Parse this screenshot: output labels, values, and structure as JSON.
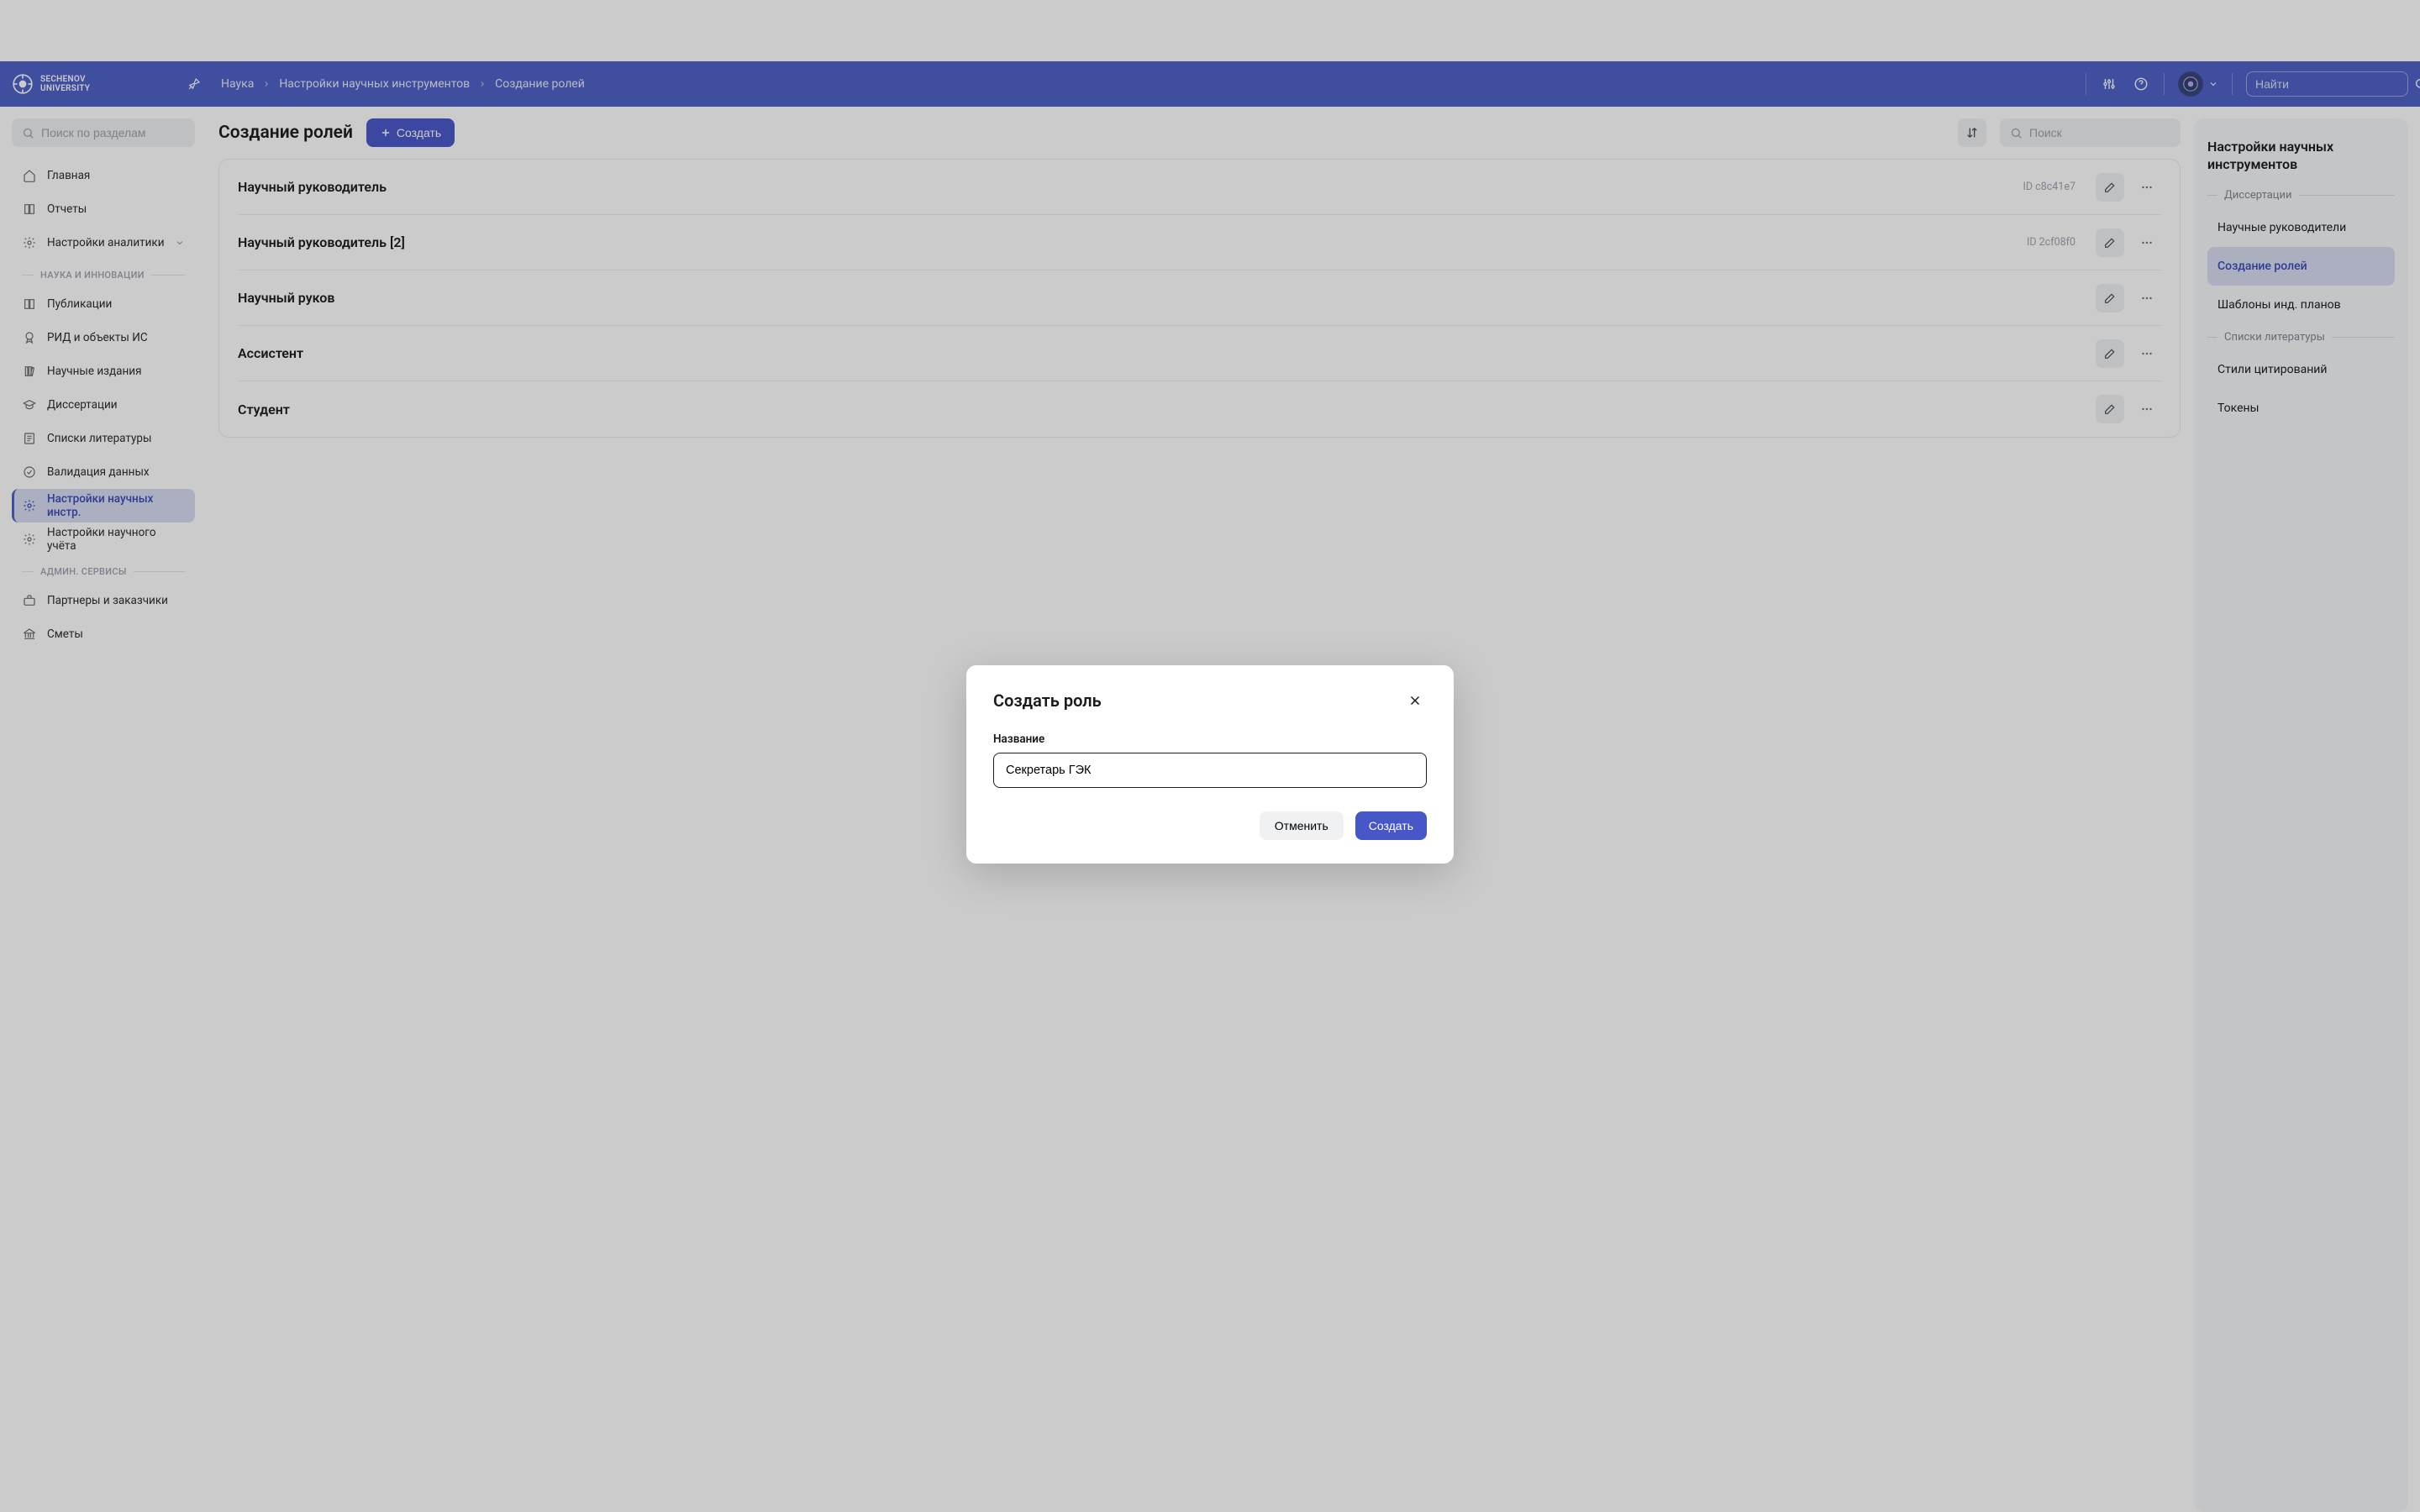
{
  "brand": {
    "name": "SECHENOV",
    "sub": "UNIVERSITY"
  },
  "breadcrumbs": [
    "Наука",
    "Настройки научных инструментов",
    "Создание ролей"
  ],
  "topSearch": {
    "placeholder": "Найти"
  },
  "sidebar": {
    "search_placeholder": "Поиск по разделам",
    "items_top": [
      {
        "label": "Главная",
        "icon": "home"
      },
      {
        "label": "Отчеты",
        "icon": "book"
      },
      {
        "label": "Настройки аналитики",
        "icon": "gear",
        "expandable": true
      }
    ],
    "section_science": "НАУКА И ИННОВАЦИИ",
    "items_science": [
      {
        "label": "Публикации",
        "icon": "book"
      },
      {
        "label": "РИД и объекты ИС",
        "icon": "badge"
      },
      {
        "label": "Научные издания",
        "icon": "books"
      },
      {
        "label": "Диссертации",
        "icon": "grad"
      },
      {
        "label": "Списки литературы",
        "icon": "list"
      },
      {
        "label": "Валидация данных",
        "icon": "check"
      },
      {
        "label": "Настройки научных инстр.",
        "icon": "gear",
        "active": true
      },
      {
        "label": "Настройки научного учёта",
        "icon": "gear"
      }
    ],
    "section_admin": "АДМИН. СЕРВИСЫ",
    "items_admin": [
      {
        "label": "Партнеры и заказчики",
        "icon": "briefcase"
      },
      {
        "label": "Сметы",
        "icon": "bank"
      }
    ]
  },
  "page": {
    "title": "Создание ролей",
    "create_label": "Создать",
    "search_placeholder": "Поиск"
  },
  "roles": [
    {
      "name": "Научный руководитель",
      "id": "ID c8c41e7"
    },
    {
      "name": "Научный руководитель [2]",
      "id": "ID 2cf08f0"
    },
    {
      "name": "Научный руков",
      "id": ""
    },
    {
      "name": "Ассистент",
      "id": ""
    },
    {
      "name": "Студент",
      "id": ""
    }
  ],
  "rightpanel": {
    "title": "Настройки научных инструментов",
    "section_diss": "Диссертации",
    "items_diss": [
      "Научные руководители",
      "Создание ролей",
      "Шаблоны инд. планов"
    ],
    "active_index": 1,
    "section_lit": "Списки литературы",
    "items_lit": [
      "Стили цитирований",
      "Токены"
    ]
  },
  "modal": {
    "title": "Создать роль",
    "field_label": "Название",
    "field_value": "Секретарь ГЭК",
    "cancel": "Отменить",
    "submit": "Создать"
  }
}
